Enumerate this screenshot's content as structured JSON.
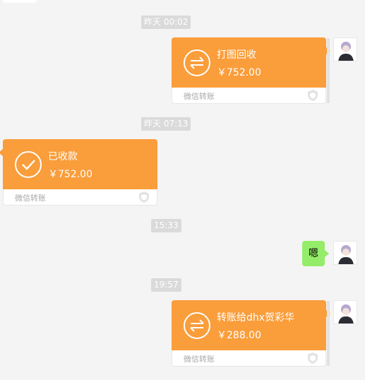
{
  "colors": {
    "background": "#f4f4f4",
    "transfer_orange": "#fa9d3b",
    "text_bubble_green": "#95ec69",
    "timestamp_bg": "#dadada"
  },
  "messages": {
    "ts1": "昨天 00:02",
    "transfer1": {
      "title": "打图回收",
      "amount": "￥752.00",
      "footer": "微信转账",
      "icon": "transfer-arrows-icon",
      "side": "right"
    },
    "ts2": "昨天 07:13",
    "transfer2": {
      "title": "已收款",
      "amount": "￥752.00",
      "footer": "微信转账",
      "icon": "checkmark-icon",
      "side": "left"
    },
    "ts3": "15:33",
    "text1": {
      "text": "嗯",
      "side": "right"
    },
    "ts4": "19:57",
    "transfer3": {
      "title": "转账给dhx贺彩华",
      "amount": "￥288.00",
      "footer": "微信转账",
      "icon": "transfer-arrows-icon",
      "side": "right"
    }
  }
}
